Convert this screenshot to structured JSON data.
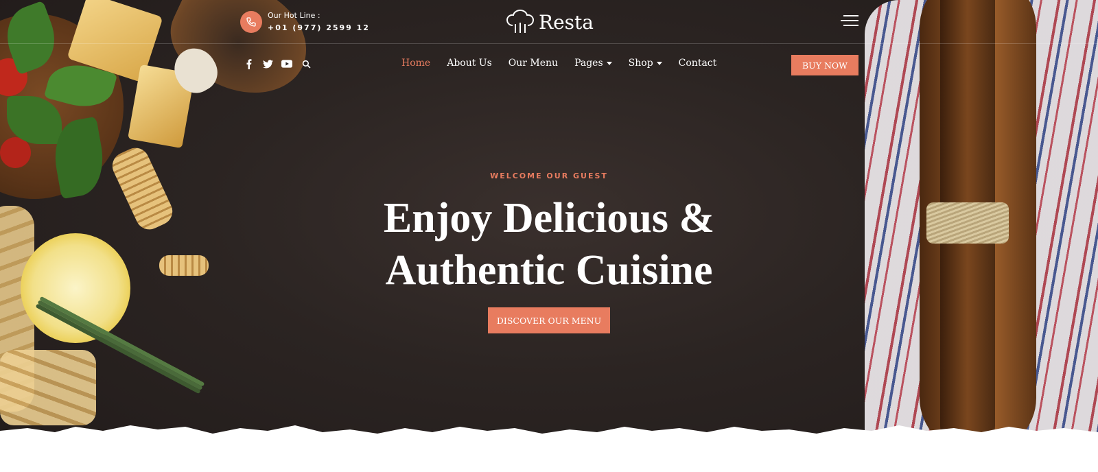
{
  "brand": {
    "name": "Resta",
    "accent_color": "#e87c5f"
  },
  "topbar": {
    "hotline_label": "Our Hot Line :",
    "hotline_number": "+01 (977) 2599 12",
    "hotline_icon": "phone-icon",
    "menu_icon": "hamburger-menu-icon"
  },
  "social": {
    "icons": [
      "facebook-icon",
      "twitter-icon",
      "youtube-icon",
      "search-icon"
    ]
  },
  "nav": {
    "items": [
      {
        "label": "Home",
        "active": true
      },
      {
        "label": "About Us"
      },
      {
        "label": "Our Menu"
      },
      {
        "label": "Pages",
        "dropdown": true
      },
      {
        "label": "Shop",
        "dropdown": true
      },
      {
        "label": "Contact"
      }
    ],
    "buy_label": "BUY NOW"
  },
  "hero": {
    "eyebrow": "WELCOME OUR GUEST",
    "headline_line1": "Enjoy Delicious &",
    "headline_line2": "Authentic Cuisine",
    "cta_label": "DISCOVER OUR MENU"
  }
}
